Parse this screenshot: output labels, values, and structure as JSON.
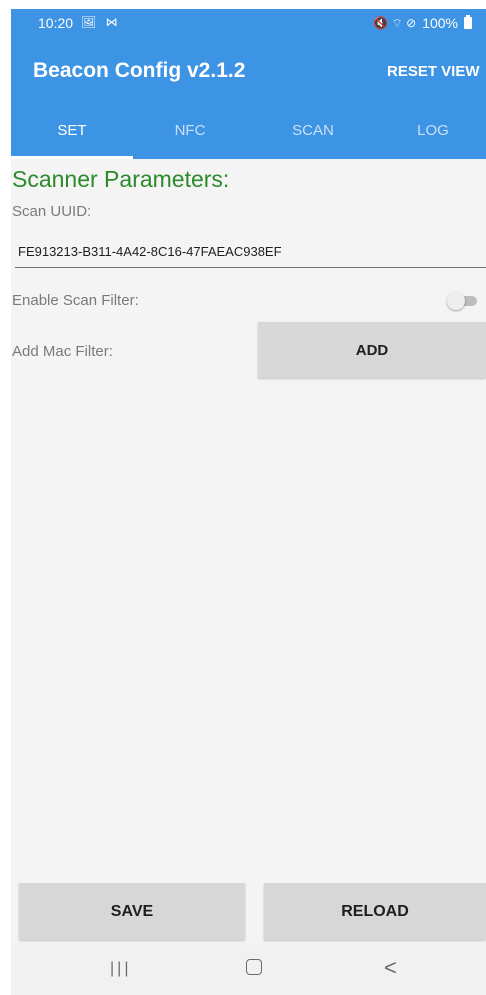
{
  "status_bar": {
    "time": "10:20",
    "left_icons": "🖼 ⋈",
    "right_icons": "🔇 ⌔ ⊘",
    "battery_text": "100%"
  },
  "app_bar": {
    "title": "Beacon Config v2.1.2",
    "reset_view_label": "RESET VIEW"
  },
  "tabs": [
    {
      "label": "SET",
      "active": true
    },
    {
      "label": "NFC",
      "active": false
    },
    {
      "label": "SCAN",
      "active": false
    },
    {
      "label": "LOG",
      "active": false
    }
  ],
  "scanner": {
    "section_title": "Scanner Parameters:",
    "uuid_label": "Scan UUID:",
    "uuid_value": "FE913213-B311-4A42-8C16-47FAEAC938EF",
    "filter_label": "Enable Scan Filter:",
    "filter_enabled": false,
    "mac_filter_label": "Add Mac Filter:",
    "add_label": "ADD"
  },
  "footer": {
    "save_label": "SAVE",
    "reload_label": "RELOAD"
  },
  "nav_bar": {
    "recent_icon": "recent-apps-icon",
    "home_icon": "home-icon",
    "back_icon": "back-icon",
    "recent_glyph": "|||",
    "back_glyph": "<"
  },
  "colors": {
    "app_bar": "#3d93e4",
    "section_title": "#2b8a2b",
    "button_bg": "#d7d7d7"
  }
}
